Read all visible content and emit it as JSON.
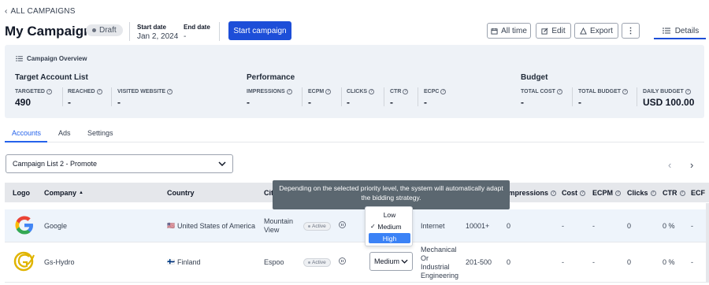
{
  "nav": {
    "back_label": "ALL CAMPAIGNS"
  },
  "header": {
    "title": "My Campaign",
    "status": "Draft",
    "start_date_label": "Start date",
    "start_date": "Jan 2, 2024",
    "end_date_label": "End date",
    "end_date": "-",
    "start_button": "Start campaign",
    "all_time": "All time",
    "edit": "Edit",
    "export": "Export",
    "more": "⋮",
    "details": "Details"
  },
  "overview": {
    "title": "Campaign Overview",
    "target": {
      "title": "Target Account List",
      "targeted_label": "TARGETED",
      "targeted": "490",
      "reached_label": "REACHED",
      "reached": "-",
      "visited_label": "VISITED WEBSITE",
      "visited": "-"
    },
    "performance": {
      "title": "Performance",
      "impressions_label": "IMPRESSIONS",
      "impressions": "-",
      "ecpm_label": "ECPM",
      "ecpm": "-",
      "clicks_label": "CLICKS",
      "clicks": "-",
      "ctr_label": "CTR",
      "ctr": "-",
      "ecpc_label": "ECPC",
      "ecpc": "-"
    },
    "budget": {
      "title": "Budget",
      "total_cost_label": "TOTAL COST",
      "total_cost": "-",
      "total_budget_label": "TOTAL BUDGET",
      "total_budget": "-",
      "daily_budget_label": "DAILY BUDGET",
      "daily_budget": "USD 100.00"
    }
  },
  "tabs": [
    "Accounts",
    "Ads",
    "Settings"
  ],
  "list_select": {
    "value": "Campaign List 2 - Promote"
  },
  "pagination": {
    "prev": "‹",
    "next": "›"
  },
  "table": {
    "headers": [
      "Logo",
      "Company",
      "Country",
      "Cit",
      "Impressions",
      "Cost",
      "ECPM",
      "Clicks",
      "CTR",
      "ECF"
    ],
    "rows": [
      {
        "company": "Google",
        "flag": "🇺🇸",
        "country": "United States of America",
        "city": [
          "Mountain",
          "View"
        ],
        "status": "Active",
        "industry": "Internet",
        "size": "10001+",
        "impressions": "0",
        "cost": "-",
        "ecpm": "-",
        "clicks": "0",
        "ctr": "0 %",
        "ecpc": "-"
      },
      {
        "company": "Gs-Hydro",
        "flag": "🇫🇮",
        "country": "Finland",
        "city": [
          "Espoo"
        ],
        "status": "Active",
        "priority": "Medium",
        "industry": [
          "Mechanical",
          "Or",
          "Industrial",
          "Engineering"
        ],
        "size": "201-500",
        "impressions": "0",
        "cost": "-",
        "ecpm": "-",
        "clicks": "0",
        "ctr": "0 %",
        "ecpc": "-"
      }
    ]
  },
  "tooltip": {
    "text": "Depending on the selected priority level, the system will automatically adapt the bidding strategy."
  },
  "priority_menu": {
    "options": [
      "Low",
      "Medium",
      "High"
    ],
    "checkmark": "✓"
  },
  "colors": {
    "accent": "#1d4ed8",
    "overview_bg": "#eef2f7",
    "tooltip_bg": "#5b6770",
    "highlight": "#3b82f6"
  }
}
